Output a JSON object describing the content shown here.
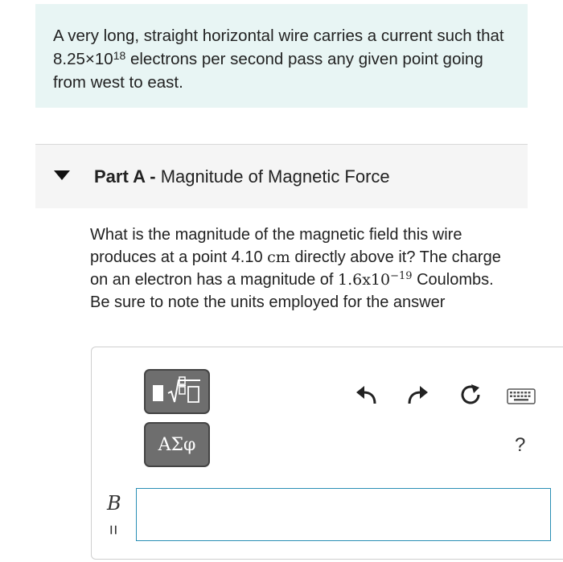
{
  "intro": {
    "text_before_exp": "A very long, straight horizontal wire carries a current such that 8.25×10",
    "exponent": "18",
    "text_after_exp": " electrons per second pass any given point going from west to east."
  },
  "part": {
    "label": "Part A -",
    "title": "Magnitude of Magnetic Force"
  },
  "question": {
    "text1": "What is the magnitude of the magnetic field this wire produces at a point 4.10 ",
    "unit_cm": "cm",
    "text2": " directly above it? The charge on an electron has a magnitude of ",
    "charge_base": "1.6x10",
    "charge_exp": "−19",
    "text3": " Coulombs. Be sure to note the units employed for the answer"
  },
  "toolbar": {
    "symbols_label": "ΑΣφ",
    "help_label": "?",
    "icons": [
      "templates-icon",
      "undo-icon",
      "redo-icon",
      "reset-icon",
      "keyboard-icon",
      "help-icon"
    ]
  },
  "answer": {
    "variable": "B",
    "equals": "=",
    "value": ""
  },
  "colors": {
    "intro_bg": "#e8f5f4",
    "part_header_bg": "#f5f5f5",
    "button_bg": "#6e6e6e",
    "input_border": "#2a8fb5"
  }
}
